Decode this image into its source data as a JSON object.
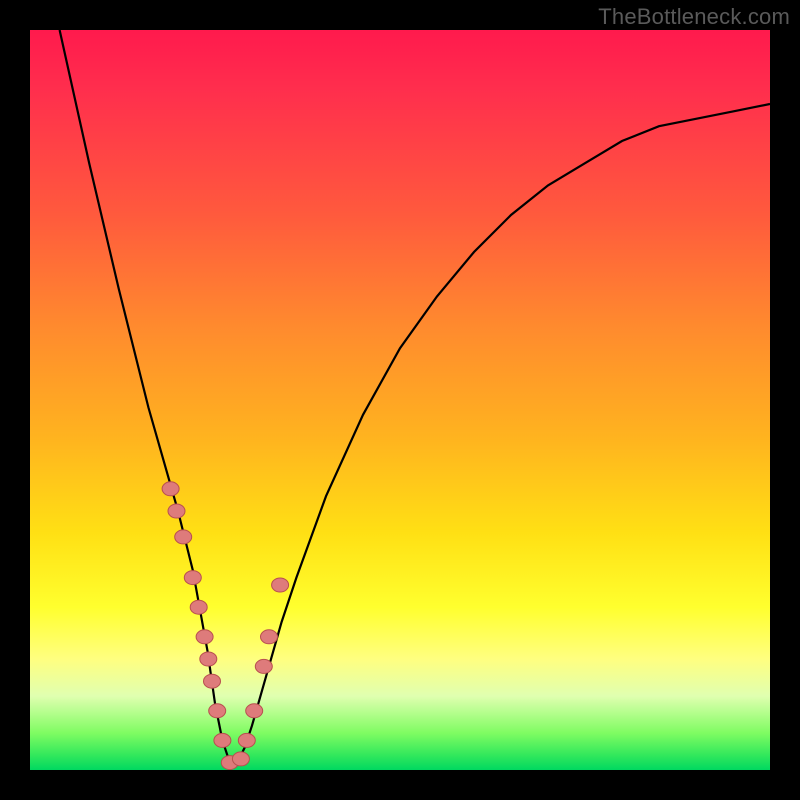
{
  "watermark": "TheBottleneck.com",
  "colors": {
    "frame": "#000000",
    "gradient_top": "#ff1a4d",
    "gradient_mid": "#ffe014",
    "gradient_bottom": "#00d860",
    "curve": "#000000",
    "marker_fill": "#de7b7b",
    "marker_stroke": "#b84f4f"
  },
  "chart_data": {
    "type": "line",
    "title": "",
    "xlabel": "",
    "ylabel": "",
    "xlim": [
      0,
      100
    ],
    "ylim": [
      0,
      100
    ],
    "note": "V-shaped bottleneck curve. x is an arbitrary component-balance axis (0–100); y is bottleneck percentage (0 = no bottleneck at green bottom, 100 = full bottleneck at red top). Minimum of the curve is near x≈27. Markers are highlighted sample points on the curve.",
    "series": [
      {
        "name": "bottleneck-curve",
        "x": [
          4,
          8,
          12,
          16,
          18,
          20,
          22,
          24,
          25,
          26,
          27,
          28,
          29,
          30,
          32,
          34,
          36,
          40,
          45,
          50,
          55,
          60,
          65,
          70,
          75,
          80,
          85,
          90,
          95,
          100
        ],
        "y": [
          100,
          82,
          65,
          49,
          42,
          35,
          27,
          16,
          9,
          4,
          1,
          1,
          3,
          6,
          13,
          20,
          26,
          37,
          48,
          57,
          64,
          70,
          75,
          79,
          82,
          85,
          87,
          88,
          89,
          90
        ]
      }
    ],
    "markers": {
      "name": "highlighted-points",
      "x": [
        19.0,
        19.8,
        20.7,
        22.0,
        22.8,
        23.6,
        24.1,
        24.6,
        25.3,
        26.0,
        27.0,
        28.5,
        29.3,
        30.3,
        31.6,
        32.3,
        33.8
      ],
      "y": [
        38.0,
        35.0,
        31.5,
        26.0,
        22.0,
        18.0,
        15.0,
        12.0,
        8.0,
        4.0,
        1.0,
        1.5,
        4.0,
        8.0,
        14.0,
        18.0,
        25.0
      ]
    }
  }
}
